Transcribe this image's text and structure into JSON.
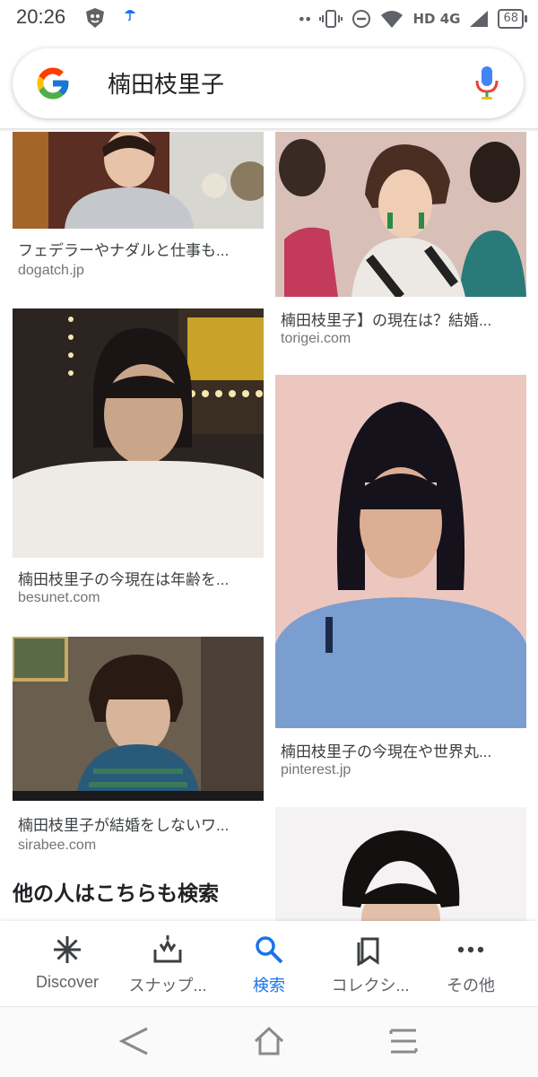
{
  "status_bar": {
    "time": "20:26",
    "network": "HD 4G",
    "battery": "68"
  },
  "search": {
    "query": "楠田枝里子"
  },
  "results": {
    "left": [
      {
        "caption": "フェデラーやナダルと仕事も...",
        "source": "dogatch.jp"
      },
      {
        "caption": "楠田枝里子の今現在は年齢を...",
        "source": "besunet.com"
      },
      {
        "caption": "楠田枝里子が結婚をしないワ...",
        "source": "sirabee.com"
      }
    ],
    "right": [
      {
        "caption": "楠田枝里子】の現在は？結婚...",
        "source": "torigei.com"
      },
      {
        "caption": "楠田枝里子の今現在や世界丸...",
        "source": "pinterest.jp"
      }
    ]
  },
  "section_heading": "他の人はこちらも検索",
  "bottom_nav": {
    "items": [
      {
        "label": "Discover",
        "icon": "asterisk-icon"
      },
      {
        "label": "スナップ...",
        "icon": "snapshot-tray-icon"
      },
      {
        "label": "検索",
        "icon": "search-icon",
        "active": true
      },
      {
        "label": "コレクシ...",
        "icon": "collections-icon"
      },
      {
        "label": "その他",
        "icon": "more-dots-icon"
      }
    ]
  },
  "colors": {
    "accent": "#1a73e8",
    "text_primary": "#202124",
    "text_secondary": "#70757a"
  }
}
